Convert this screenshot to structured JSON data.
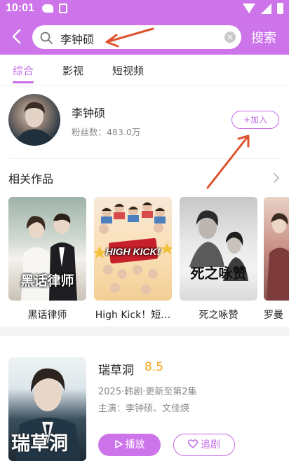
{
  "status_bar": {
    "time": "10:01"
  },
  "header": {
    "search_value": "李钟硕",
    "clear_glyph": "×",
    "search_label": "搜索"
  },
  "tabs": [
    {
      "label": "综合",
      "active": true
    },
    {
      "label": "影视",
      "active": false
    },
    {
      "label": "短视频",
      "active": false
    }
  ],
  "artist": {
    "name": "李钟硕",
    "fans": "粉丝数：483.0万",
    "join_label": "+加入"
  },
  "related": {
    "title": "相关作品",
    "works": [
      {
        "label": "黑话律师",
        "poster_text": "黑话律师"
      },
      {
        "label": "High Kick！短…",
        "poster_text": "HIGH KICK!"
      },
      {
        "label": "死之咏赞",
        "poster_text": "死之咏赞"
      },
      {
        "label": "罗曼",
        "poster_text": ""
      }
    ]
  },
  "drama": {
    "title": "瑞草洞",
    "rating": "8.5",
    "meta": "2025·韩剧·更新至第2集",
    "cast": "主演：李钟硕、文佳煐",
    "poster_text": "瑞草洞",
    "play_label": "播放",
    "follow_label": "追剧"
  },
  "colors": {
    "accent": "#cd74eb",
    "rating": "#f2a518",
    "annotation_arrow": "#e0532f"
  },
  "icons": [
    "back-icon",
    "search-icon",
    "clear-icon",
    "chevron-right-icon",
    "play-icon",
    "heart-icon"
  ]
}
